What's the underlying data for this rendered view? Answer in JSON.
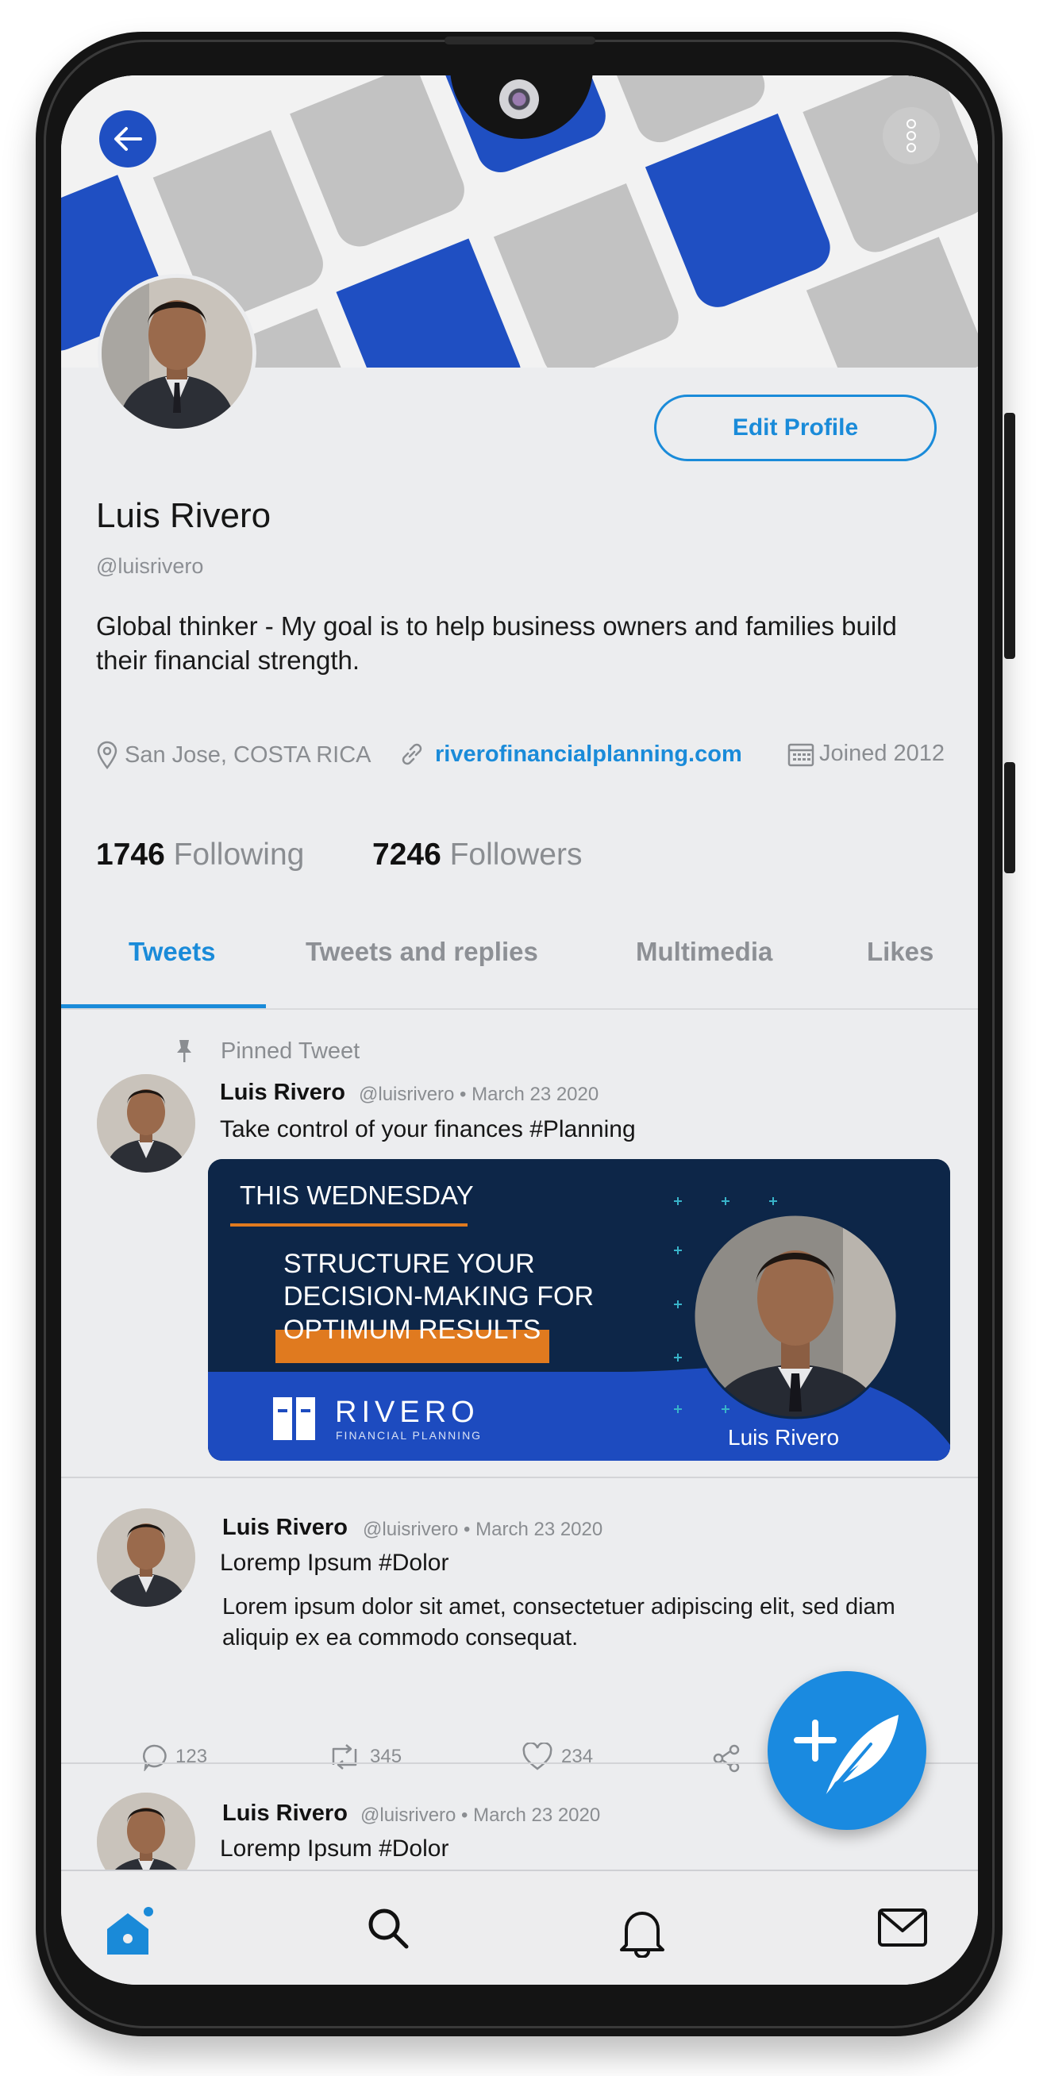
{
  "profile": {
    "name": "Luis Rivero",
    "handle": "@luisrivero",
    "bio": "Global thinker - My goal is to help business owners and families build their financial strength.",
    "location": "San Jose, COSTA RICA",
    "website": "riverofinancialplanning.com",
    "joined": "Joined 2012",
    "following_count": "1746",
    "following_label": "Following",
    "followers_count": "7246",
    "followers_label": "Followers",
    "edit_label": "Edit Profile"
  },
  "tabs": [
    {
      "label": "Tweets",
      "active": true
    },
    {
      "label": "Tweets and replies",
      "active": false
    },
    {
      "label": "Multimedia",
      "active": false
    },
    {
      "label": "Likes",
      "active": false
    }
  ],
  "pinned": {
    "label": "Pinned Tweet",
    "name": "Luis Rivero",
    "meta": "@luisrivero • March 23 2020",
    "text": "Take control of your finances #Planning",
    "promo": {
      "kicker": "THIS WEDNESDAY",
      "line1": "STRUCTURE YOUR",
      "line2": "DECISION-MAKING FOR",
      "highlight": "OPTIMUM RESULTS",
      "brand": "RIVERO",
      "brand_sub": "FINANCIAL PLANNING",
      "caption": "Luis Rivero"
    }
  },
  "tweets": [
    {
      "name": "Luis Rivero",
      "meta": "@luisrivero • March 23 2020",
      "title": "Loremp Ipsum #Dolor",
      "body": "Lorem ipsum dolor sit amet, consectetuer adipiscing elit, sed diam aliquip ex ea commodo consequat.",
      "replies": "123",
      "retweets": "345",
      "likes": "234"
    },
    {
      "name": "Luis Rivero",
      "meta": "@luisrivero • March 23 2020",
      "title": "Loremp Ipsum #Dolor"
    }
  ],
  "colors": {
    "accent": "#1a8bd9",
    "banner_blue": "#1f4fc2",
    "promo_navy": "#0d2648",
    "promo_orange": "#e07a1f"
  },
  "icons": {
    "nav": [
      "home-icon",
      "search-icon",
      "bell-icon",
      "mail-icon"
    ],
    "actions": [
      "reply-icon",
      "retweet-icon",
      "heart-icon",
      "share-icon"
    ]
  }
}
